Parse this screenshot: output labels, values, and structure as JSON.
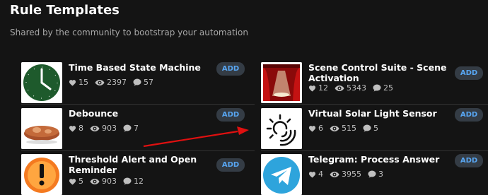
{
  "header": {
    "title": "Rule Templates",
    "subtitle": "Shared by the community to bootstrap your automation"
  },
  "add_label": "ADD",
  "colors": {
    "accent": "#58a6f2",
    "button_bg": "#343c45",
    "background": "#141414"
  },
  "templates": [
    {
      "name": "Time Based State Machine",
      "likes": "15",
      "views": "2397",
      "comments": "57",
      "icon": "clock-icon"
    },
    {
      "name": "Scene Control Suite - Scene Activation",
      "likes": "12",
      "views": "5343",
      "comments": "25",
      "icon": "stage-spotlight-icon"
    },
    {
      "name": "Debounce",
      "likes": "8",
      "views": "903",
      "comments": "7",
      "icon": "bread-icon"
    },
    {
      "name": "Virtual Solar Light Sensor",
      "likes": "6",
      "views": "515",
      "comments": "5",
      "icon": "sun-icon"
    },
    {
      "name": "Threshold Alert and Open Reminder",
      "likes": "5",
      "views": "903",
      "comments": "12",
      "icon": "alert-icon"
    },
    {
      "name": "Telegram: Process Answer",
      "likes": "4",
      "views": "3955",
      "comments": "3",
      "icon": "telegram-icon"
    }
  ]
}
